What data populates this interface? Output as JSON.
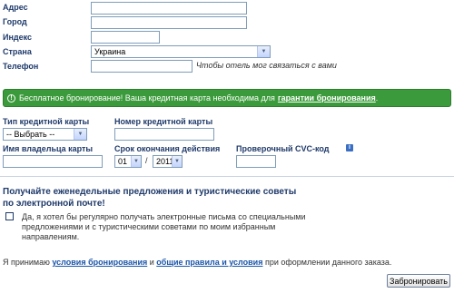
{
  "address_form": {
    "address_label": "Адрес",
    "city_label": "Город",
    "zip_label": "Индекс",
    "country_label": "Страна",
    "country_value": "Украина",
    "phone_label": "Телефон",
    "phone_hint": "Чтобы отель мог связаться с вами"
  },
  "banner": {
    "icon": "!",
    "text": "Бесплатное бронирование! Ваша кредитная карта необходима для",
    "link": "гарантии бронирования",
    "period": "."
  },
  "card_form": {
    "card_type_label": "Тип кредитной карты",
    "card_type_value": "-- Выбрать --",
    "card_number_label": "Номер кредитной карты",
    "holder_label": "Имя владельца карты",
    "expiry_label": "Срок окончания действия",
    "expiry_month": "01",
    "expiry_separator": "/",
    "expiry_year": "2011",
    "cvc_label": "Проверочный CVC-код",
    "cvc_info_icon": "i"
  },
  "promo": {
    "title_line1": "Получайте еженедельные предложения и туристические советы",
    "title_line2": "по электронной почте!",
    "checkbox_line1": "Да, я хотел бы регулярно получать электронные письма со специальными",
    "checkbox_line2": "предложениями и с туристическими советами по моим избранным",
    "checkbox_line3": "направлениям."
  },
  "terms": {
    "prefix": "Я принимаю",
    "link1": "условия бронирования",
    "and": "и",
    "link2": "общие правила и условия",
    "suffix": "при оформлении данного заказа."
  },
  "submit_label": "Забронировать"
}
